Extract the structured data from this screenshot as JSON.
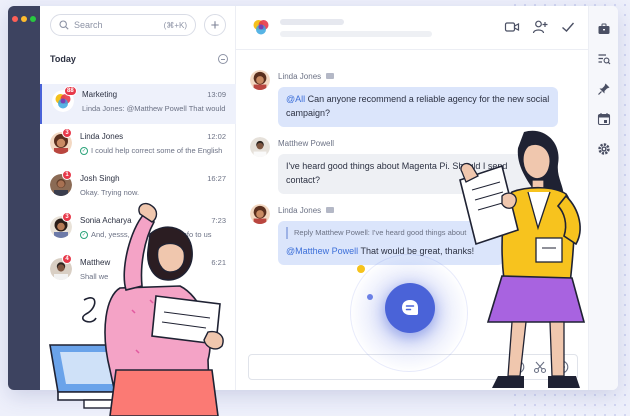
{
  "colors": {
    "accent": "#4a63d8",
    "badge": "#e7394a",
    "bubble_blue": "#dbe5fb",
    "bubble_grey": "#eef0f4",
    "rail_dark": "#3d4360"
  },
  "search": {
    "placeholder": "Search",
    "shortcut": "(⌘+K)",
    "icon": "search-icon"
  },
  "add_button": {
    "icon": "plus-icon"
  },
  "section": {
    "label": "Today"
  },
  "chats": [
    {
      "name": "Marketing",
      "time": "13:09",
      "preview": "Linda Jones: @Matthew Powell That would...",
      "badge": "88",
      "avatar": "group-logo",
      "active": true
    },
    {
      "name": "Linda Jones",
      "time": "12:02",
      "preview": "I could help correct some of the English",
      "badge": "3",
      "avatar": "linda-avatar",
      "read": true
    },
    {
      "name": "Josh Singh",
      "time": "16:27",
      "preview": "Okay. Trying now.",
      "badge": "1",
      "avatar": "josh-avatar"
    },
    {
      "name": "Sonia Acharya",
      "time": "7:23",
      "preview": "And, yesss, please put the info to us",
      "badge": "3",
      "avatar": "sonia-avatar",
      "read": true
    },
    {
      "name": "Matthew",
      "time": "6:21",
      "preview": "Shall we",
      "badge": "4",
      "avatar": "matthew-avatar"
    }
  ],
  "header": {
    "icons": [
      "video-call-icon",
      "add-user-icon",
      "checkmark-icon"
    ]
  },
  "messages": [
    {
      "sender": "Linda Jones",
      "mention": "@All",
      "text": " Can anyone recommend a reliable agency for the new social campaign?",
      "style": "blue"
    },
    {
      "sender": "Matthew Powell",
      "text": "I've heard good things about Magenta Pi. Should I send contact?",
      "style": "grey"
    },
    {
      "sender": "Linda Jones",
      "reply": "Reply Matthew Powell: I've heard good things about",
      "mention": "@Matthew Powell",
      "text": " That would be great, thanks!",
      "style": "blue"
    }
  ],
  "composer": {
    "icons": [
      "emoji-icon",
      "scissors-icon",
      "plus-circle-icon"
    ]
  },
  "rail": {
    "icons": [
      "briefcase-icon",
      "search-list-icon",
      "pin-icon",
      "calendar-icon",
      "gear-icon"
    ]
  },
  "bot": {
    "icon": "chat-bot-icon"
  }
}
